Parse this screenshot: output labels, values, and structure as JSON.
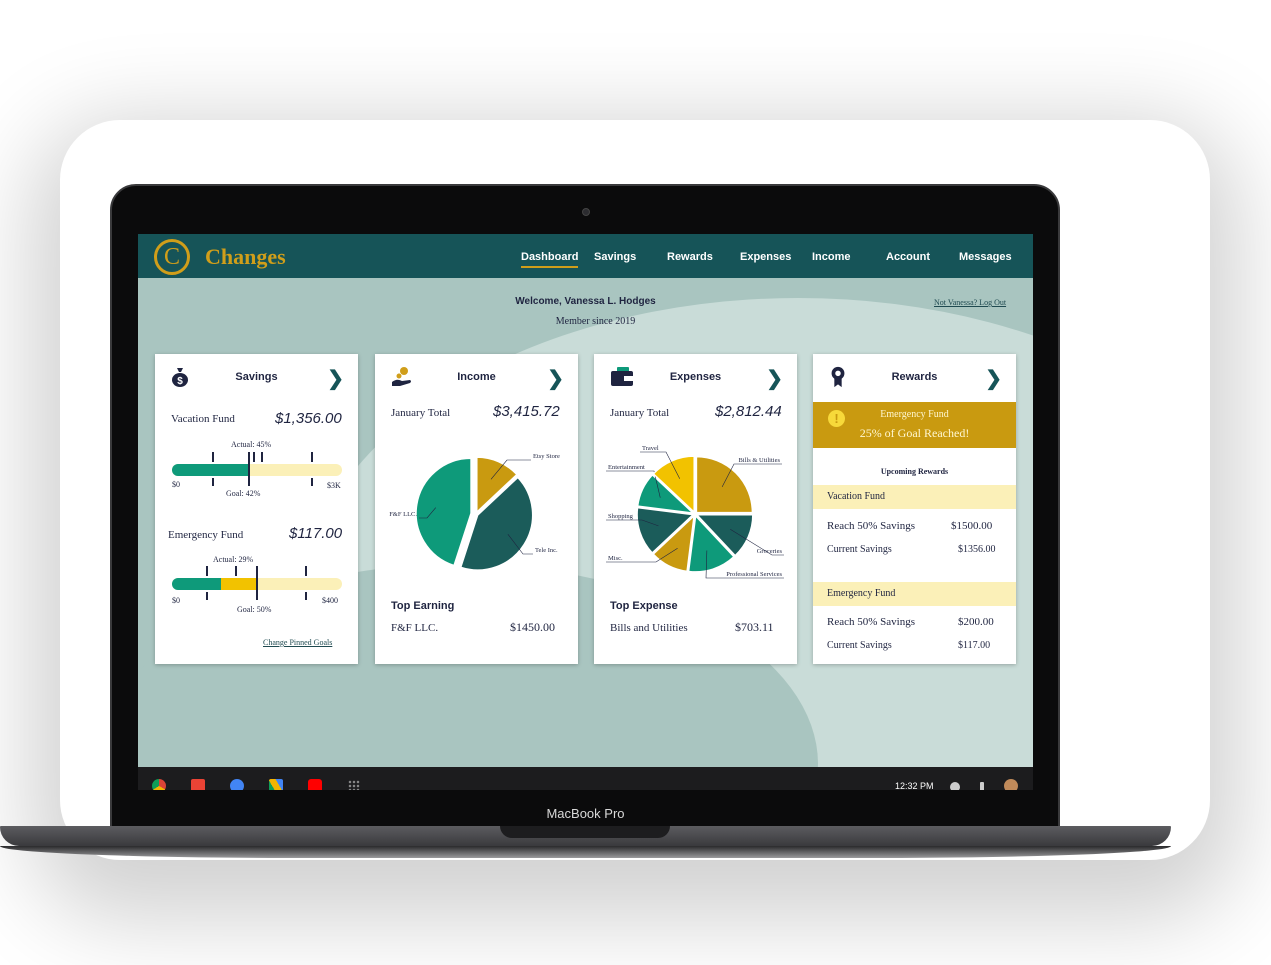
{
  "device": {
    "label": "MacBook Pro"
  },
  "app": {
    "logo_letter": "C",
    "name": "Changes",
    "nav": [
      "Dashboard",
      "Savings",
      "Rewards",
      "Expenses",
      "Income",
      "Account",
      "Messages"
    ],
    "active_nav": "Dashboard",
    "welcome": "Welcome, Vanessa L. Hodges",
    "member_since": "Member since 2019",
    "logout_link": "Not Vanessa? Log Out"
  },
  "savings": {
    "title": "Savings",
    "goals": [
      {
        "name": "Vacation Fund",
        "amount": "$1,356.00",
        "actual_label": "Actual: 45%",
        "goal_label": "Goal: 42%",
        "min": "$0",
        "max": "$3K",
        "actual": 0.45,
        "goal": 0.42
      },
      {
        "name": "Emergency Fund",
        "amount": "$117.00",
        "actual_label": "Actual: 29%",
        "goal_label": "Goal: 50%",
        "min": "$0",
        "max": "$400",
        "actual": 0.29,
        "goal": 0.5
      }
    ],
    "change_link": "Change Pinned Goals"
  },
  "income": {
    "title": "Income",
    "period_label": "January Total",
    "total": "$3,415.72",
    "top_label": "Top Earning",
    "top_name": "F&F LLC.",
    "top_amount": "$1450.00"
  },
  "expenses": {
    "title": "Expenses",
    "period_label": "January Total",
    "total": "$2,812.44",
    "top_label": "Top Expense",
    "top_name": "Bills and Utilities",
    "top_amount": "$703.11"
  },
  "rewards": {
    "title": "Rewards",
    "alert_title": "Emergency Fund",
    "alert_text": "25% of Goal Reached!",
    "upcoming_label": "Upcoming Rewards",
    "items": [
      {
        "fund": "Vacation Fund",
        "target_label": "Reach 50% Savings",
        "target": "$1500.00",
        "current_label": "Current Savings",
        "current": "$1356.00"
      },
      {
        "fund": "Emergency Fund",
        "target_label": "Reach 50% Savings",
        "target": "$200.00",
        "current_label": "Current Savings",
        "current": "$117.00"
      }
    ]
  },
  "taskbar": {
    "time": "12:32 PM"
  },
  "colors": {
    "teal_dark": "#165458",
    "gold": "#d09e1a",
    "green": "#0e9a7a",
    "dark_green": "#1b5c5a",
    "mustard": "#c99a10",
    "yellow": "#f2c200"
  },
  "chart_data": [
    {
      "type": "pie",
      "title": "",
      "labels": [
        "Etsy Store",
        "Tele Inc.",
        "F&F LLC."
      ],
      "values": [
        13,
        42,
        45
      ],
      "colors": [
        "#c99a10",
        "#1b5c5a",
        "#0e9a7a"
      ]
    },
    {
      "type": "pie",
      "title": "",
      "labels": [
        "Bills & Utilities",
        "Groceries",
        "Professional Services",
        "Misc.",
        "Shopping",
        "Entertainment",
        "Travel"
      ],
      "values": [
        25,
        13,
        14,
        11,
        14,
        10,
        13
      ],
      "colors": [
        "#c99a10",
        "#1b5c5a",
        "#0e9a7a",
        "#c99a10",
        "#1b5c5a",
        "#0e9a7a",
        "#f2c200"
      ]
    }
  ]
}
